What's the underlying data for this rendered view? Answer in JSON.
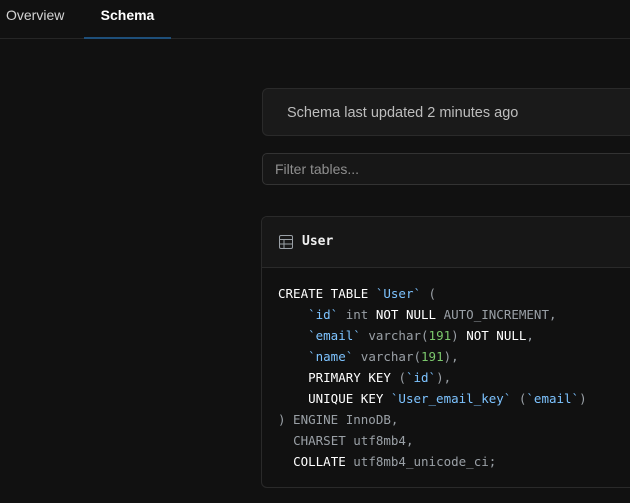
{
  "tabs": [
    {
      "label": "Overview",
      "active": false
    },
    {
      "label": "Schema",
      "active": true
    }
  ],
  "banner": {
    "text": "Schema last updated 2 minutes ago"
  },
  "filter": {
    "placeholder": "Filter tables..."
  },
  "table": {
    "name": "User",
    "icon": "table-icon",
    "sql": {
      "l1_kw": "CREATE TABLE",
      "l1_name": "`User`",
      "l1_end": "(",
      "c1_name": "`id`",
      "c1_type": "int",
      "c1_kw": "NOT NULL",
      "c1_rest": "AUTO_INCREMENT,",
      "c2_name": "`email`",
      "c2_type": "varchar(",
      "c2_len": "191",
      "c2_close": ")",
      "c2_kw": "NOT NULL",
      "c2_end": ",",
      "c3_name": "`name`",
      "c3_type": "varchar(",
      "c3_len": "191",
      "c3_end": "),",
      "pk_kw": "PRIMARY KEY",
      "pk_open": "(",
      "pk_col": "`id`",
      "pk_end": "),",
      "uk_kw": "UNIQUE KEY",
      "uk_name": "`User_email_key`",
      "uk_open": "(",
      "uk_col": "`email`",
      "uk_end": ")",
      "engine": ") ENGINE InnoDB,",
      "charset": "CHARSET utf8mb4,",
      "collate_kw": "COLLATE",
      "collate_val": "utf8mb4_unicode_ci;"
    }
  },
  "colors": {
    "background": "#111111",
    "keyword": "#ffffff",
    "identifier": "#7dc3ff",
    "number": "#7bc86c",
    "muted": "#9aa0a6",
    "active_tab_underline": "#1e4f7a"
  }
}
